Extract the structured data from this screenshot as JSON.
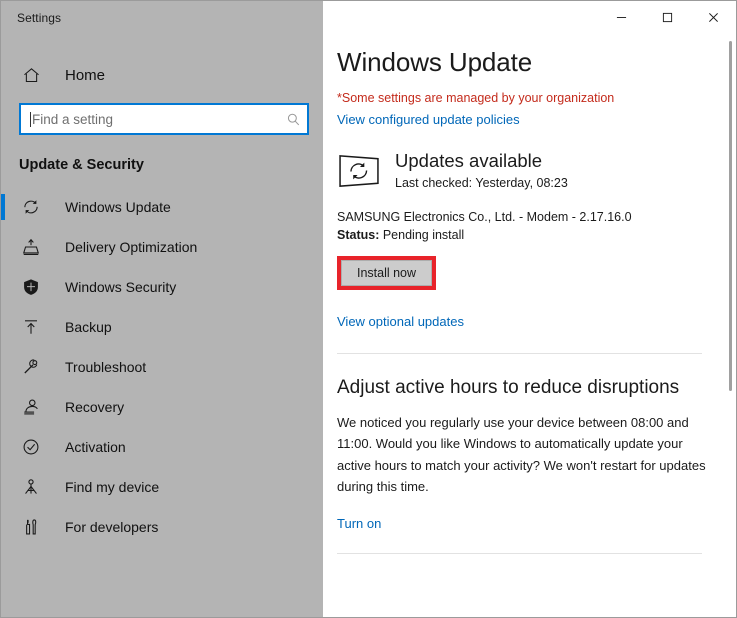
{
  "window": {
    "title": "Settings",
    "controls": [
      {
        "name": "minimize",
        "glyph": "minimize-icon"
      },
      {
        "name": "maximize",
        "glyph": "maximize-icon"
      },
      {
        "name": "close",
        "glyph": "close-icon"
      }
    ]
  },
  "sidebar": {
    "home_label": "Home",
    "home_icon": "home-icon",
    "search": {
      "placeholder": "Find a setting",
      "value": "",
      "icon": "search-icon"
    },
    "section_title": "Update & Security",
    "items": [
      {
        "label": "Windows Update",
        "icon": "refresh-icon",
        "selected": true
      },
      {
        "label": "Delivery Optimization",
        "icon": "delivery-icon",
        "selected": false
      },
      {
        "label": "Windows Security",
        "icon": "shield-icon",
        "selected": false
      },
      {
        "label": "Backup",
        "icon": "upload-arrow-icon",
        "selected": false
      },
      {
        "label": "Troubleshoot",
        "icon": "wrench-icon",
        "selected": false
      },
      {
        "label": "Recovery",
        "icon": "recovery-icon",
        "selected": false
      },
      {
        "label": "Activation",
        "icon": "check-circle-icon",
        "selected": false
      },
      {
        "label": "Find my device",
        "icon": "locate-device-icon",
        "selected": false
      },
      {
        "label": "For developers",
        "icon": "developer-tools-icon",
        "selected": false
      }
    ]
  },
  "main": {
    "page_title": "Windows Update",
    "org_notice": "*Some settings are managed by your organization",
    "policies_link": "View configured update policies",
    "status": {
      "icon": "update-monitor-icon",
      "heading": "Updates available",
      "subheading": "Last checked: Yesterday, 08:23"
    },
    "update_entry": "SAMSUNG Electronics Co., Ltd.  - Modem - 2.17.16.0",
    "status_label": "Status:",
    "status_value": " Pending install",
    "install_button": "Install now",
    "optional_updates_link": "View optional updates",
    "active_hours": {
      "heading": "Adjust active hours to reduce disruptions",
      "body": "We noticed you regularly use your device between 08:00 and 11:00. Would you like Windows to automatically update your active hours to match your activity? We won't restart for updates during this time.",
      "turn_on_link": "Turn on"
    }
  },
  "colors": {
    "sidebar_bg": "#b4b4b4",
    "accent": "#0078d4",
    "link": "#0067b8",
    "warning_red": "#c42b1c",
    "annotation_red": "#e8232a",
    "button_bg": "#cccccc"
  }
}
